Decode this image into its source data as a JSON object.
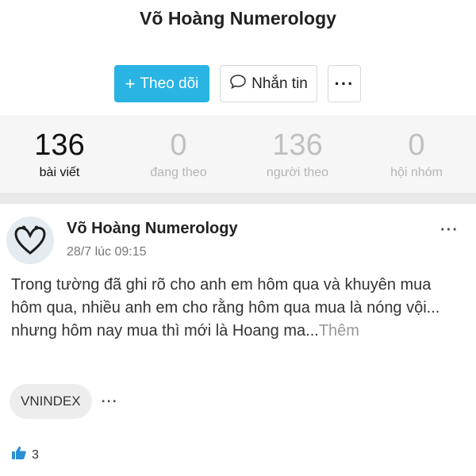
{
  "profile": {
    "name": "Võ Hoàng Numerology"
  },
  "actions": {
    "follow_label": "Theo dõi",
    "follow_icon": "plus-icon",
    "message_label": "Nhắn tin",
    "message_icon": "chat-bubble-icon",
    "more_icon": "more-horizontal-icon",
    "accent_color": "#29b4e3"
  },
  "stats": [
    {
      "value": "136",
      "label": "bài viết"
    },
    {
      "value": "0",
      "label": "đang theo"
    },
    {
      "value": "136",
      "label": "người theo"
    },
    {
      "value": "0",
      "label": "hội nhóm"
    }
  ],
  "post": {
    "author": "Võ Hoàng Numerology",
    "timestamp": "28/7 lúc 09:15",
    "text": "Trong tường đã ghi rõ cho anh em hôm qua và khuyên mua hôm qua, nhiều anh em cho rằng hôm qua mua là nóng vội... nhưng hôm nay mua thì mới là Hoang ma...",
    "more_label": "Thêm",
    "tags": [
      "VNINDEX"
    ],
    "like_count": "3",
    "like_icon": "thumbs-up-icon",
    "like_color": "#2d8fd5"
  }
}
